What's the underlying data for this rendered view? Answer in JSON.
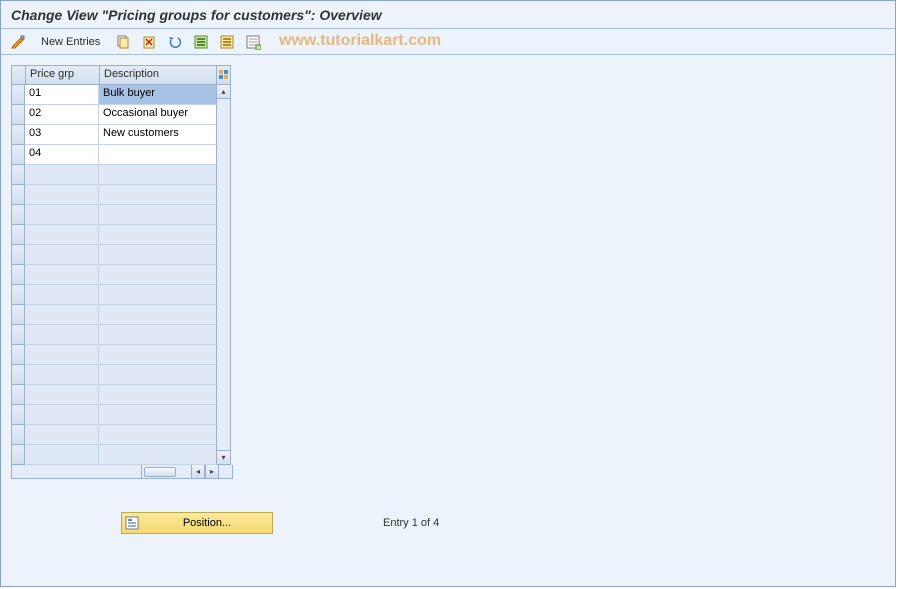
{
  "title": "Change View \"Pricing groups for customers\": Overview",
  "watermark": "www.tutorialkart.com",
  "toolbar": {
    "new_entries": "New Entries"
  },
  "table": {
    "header": {
      "col1": "Price grp",
      "col2": "Description"
    },
    "rows": [
      {
        "c1": "01",
        "c2": "Bulk buyer",
        "selected": true
      },
      {
        "c1": "02",
        "c2": "Occasional buyer"
      },
      {
        "c1": "03",
        "c2": "New customers"
      },
      {
        "c1": "04",
        "c2": ""
      }
    ],
    "empty_rows": 15
  },
  "footer": {
    "position_label": "Position...",
    "entry_text": "Entry 1 of 4"
  }
}
